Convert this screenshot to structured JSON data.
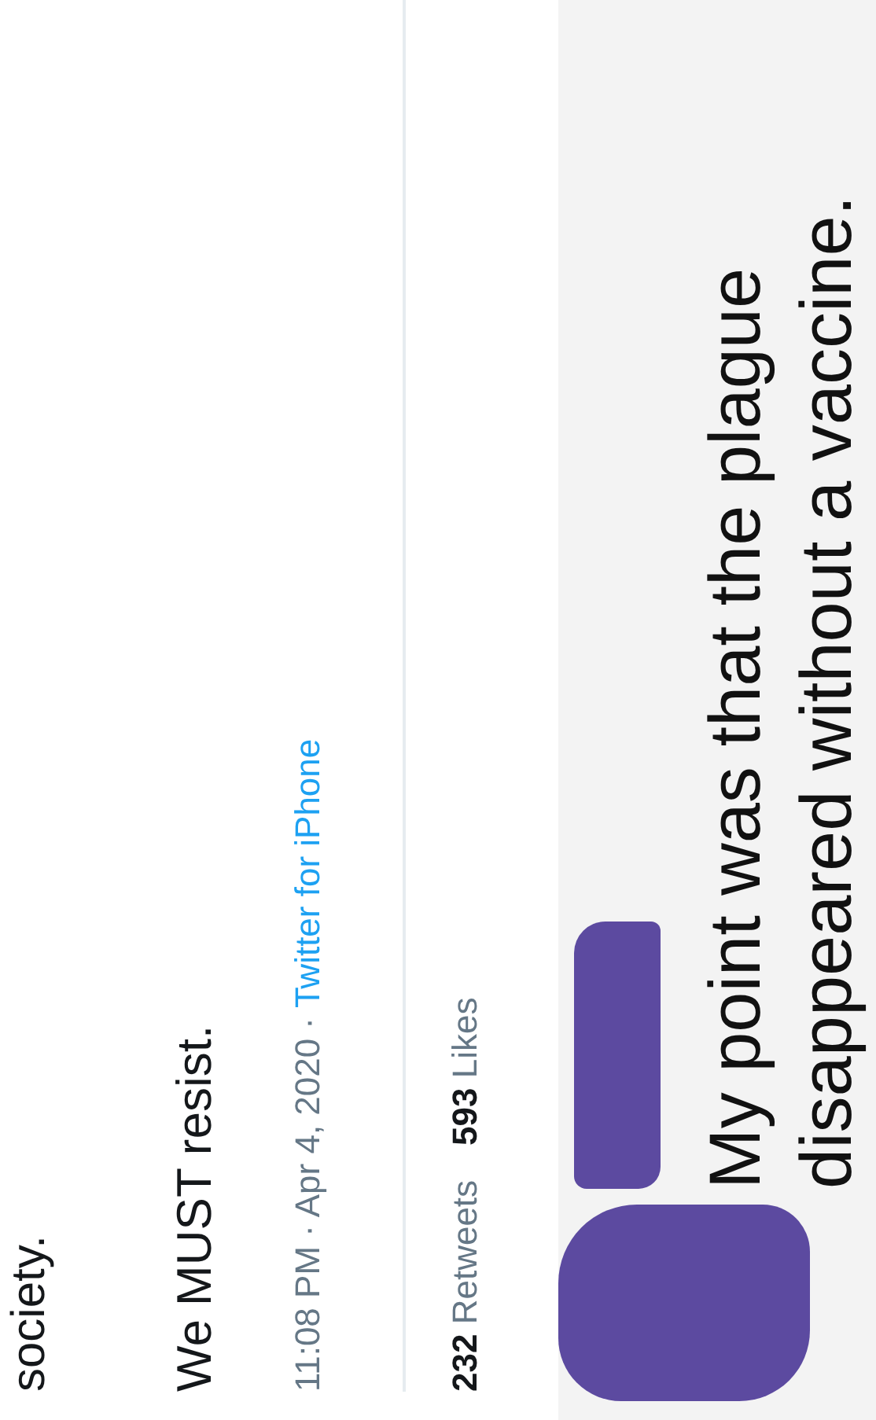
{
  "tweet": {
    "text_fragment": "society.",
    "text": "We MUST resist.",
    "timestamp": "11:08 PM · Apr 4, 2020",
    "separator": "·",
    "source": "Twitter for iPhone",
    "retweets_count": "232",
    "retweets_label": "Retweets",
    "likes_count": "593",
    "likes_label": "Likes"
  },
  "reply": {
    "lines": [
      "My point was that the plague",
      "disappeared without a vaccine."
    ]
  }
}
